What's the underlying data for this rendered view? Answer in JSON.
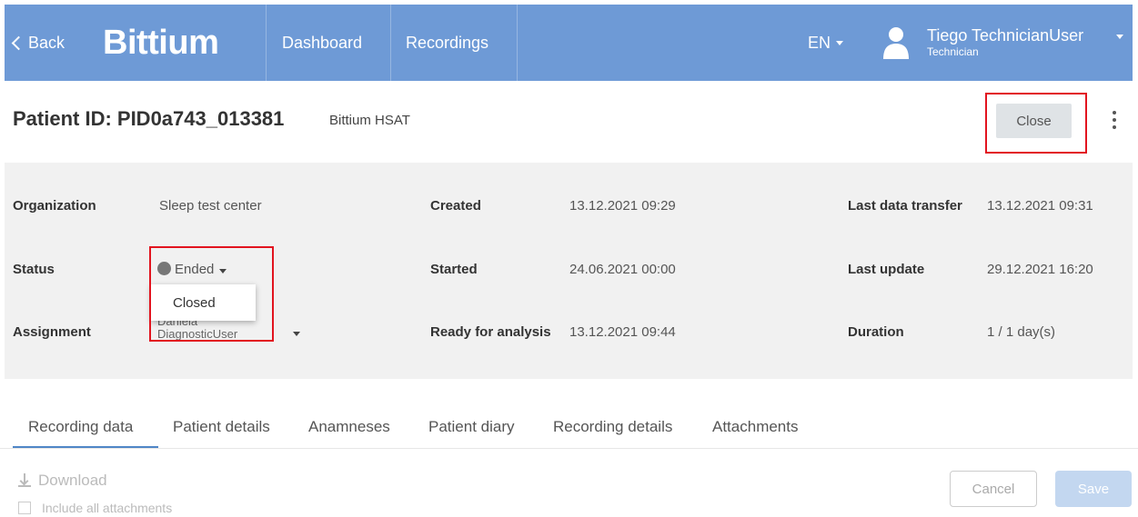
{
  "header": {
    "back_label": "Back",
    "brand": "Bittium",
    "nav": {
      "dashboard": "Dashboard",
      "recordings": "Recordings"
    },
    "language": "EN",
    "user": {
      "name": "Tiego TechnicianUser",
      "role": "Technician"
    },
    "icons": {
      "back": "chevron-left-icon",
      "user": "user-icon",
      "caret": "caret-down-icon"
    },
    "colors": {
      "bar": "#6e9ad6"
    }
  },
  "patient": {
    "title": "Patient ID: PID0a743_013381",
    "device": "Bittium HSAT",
    "close_label": "Close"
  },
  "info": {
    "organization_label": "Organization",
    "organization_value": "Sleep test center",
    "status_label": "Status",
    "status_value": "Ended",
    "status_options": [
      "Closed"
    ],
    "assignment_label": "Assignment",
    "assignment_value": "Daniela DiagnosticUser",
    "created_label": "Created",
    "created_value": "13.12.2021 09:29",
    "started_label": "Started",
    "started_value": "24.06.2021 00:00",
    "ready_label": "Ready for analysis",
    "ready_value": "13.12.2021 09:44",
    "last_transfer_label": "Last data transfer",
    "last_transfer_value": "13.12.2021 09:31",
    "last_update_label": "Last update",
    "last_update_value": "29.12.2021 16:20",
    "duration_label": "Duration",
    "duration_value": "1 / 1 day(s)"
  },
  "tabs": [
    {
      "label": "Recording data",
      "active": true
    },
    {
      "label": "Patient details"
    },
    {
      "label": "Anamneses"
    },
    {
      "label": "Patient diary"
    },
    {
      "label": "Recording details"
    },
    {
      "label": "Attachments"
    }
  ],
  "footer": {
    "download_label": "Download",
    "include_label": "Include all attachments",
    "cancel_label": "Cancel",
    "save_label": "Save"
  }
}
